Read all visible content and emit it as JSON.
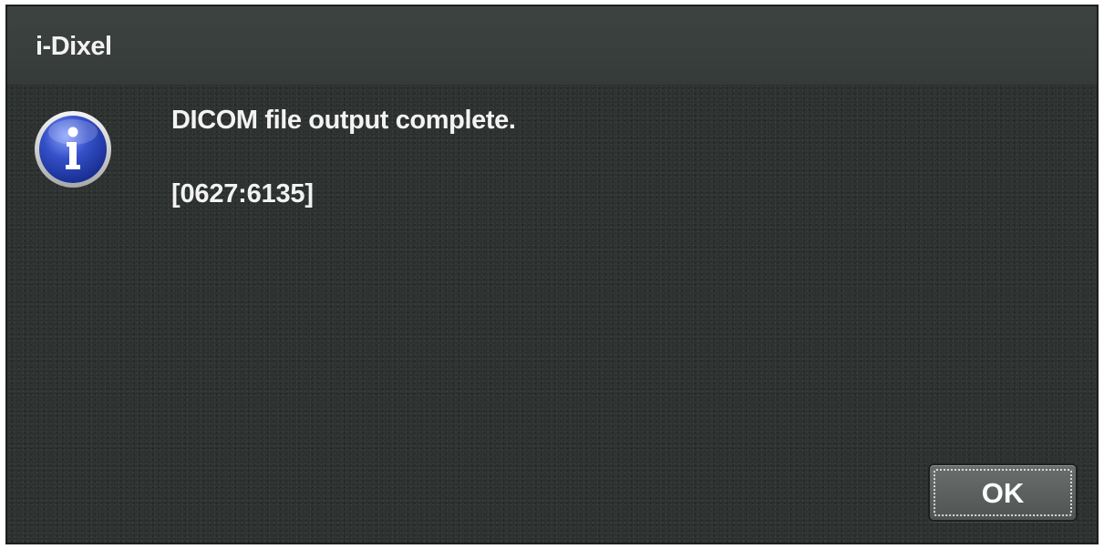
{
  "window": {
    "title": "i-Dixel"
  },
  "dialog": {
    "icon": "info-icon",
    "message": "DICOM file output complete.",
    "code": "[0627:6135]",
    "ok_label": "OK"
  },
  "colors": {
    "background": "#2b302e",
    "titlebar": "#3a3f3d",
    "text": "#f3f3f3",
    "icon_blue": "#2c46b8"
  }
}
